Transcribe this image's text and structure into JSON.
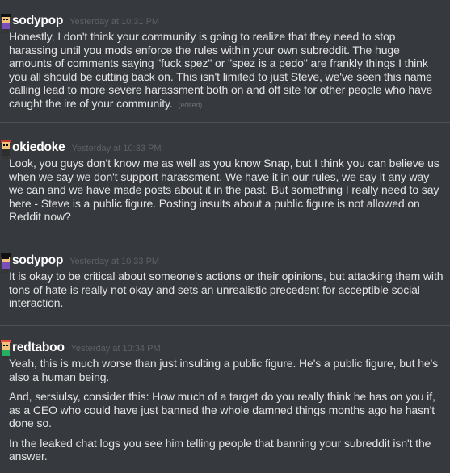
{
  "messages": [
    {
      "author": "sodypop",
      "timestamp": "Yesterday at 10:31 PM",
      "paragraphs": [
        "Honestly, I don't think your community is going to realize that they need to stop harassing until you mods enforce the rules within your own subreddit. The huge amounts of comments saying \"fuck spez\" or \"spez is a pedo\" are frankly things I think you all should be cutting back on. This isn't limited to just Steve, we've seen this name calling lead to more severe harassment both on and off site for other people who have caught the ire of your community."
      ],
      "edited": "(edited)"
    },
    {
      "author": "okiedoke",
      "timestamp": "Yesterday at 10:33 PM",
      "paragraphs": [
        "Look, you guys don't know me as well as you know Snap, but I think you can believe us when we say we don't support harassment. We have it in our rules, we say it any way we can and we have made posts about it in the past. But something I really need to say here - Steve is a public figure. Posting insults about a public figure is not allowed on Reddit now?"
      ]
    },
    {
      "author": "sodypop",
      "timestamp": "Yesterday at 10:33 PM",
      "paragraphs": [
        "It is okay to be critical about someone's actions or their opinions, but attacking them with tons of hate is really not okay and sets an unrealistic precedent for acceptible social interaction."
      ]
    },
    {
      "author": "redtaboo",
      "timestamp": "Yesterday at 10:34 PM",
      "paragraphs": [
        "Yeah, this is much worse than just insulting a public figure. He's a public figure, but he's also a human being.",
        "And, sersiulsy, consider this: How much of a target do you really think he has on you if, as a CEO who could have just banned the whole damned things months ago he hasn't done so.",
        "In the leaked chat logs you see him telling people that banning your subreddit isn't the answer."
      ]
    }
  ],
  "colors": {
    "background": "#36393e",
    "author": "#ffffff",
    "timestamp": "#5e6168",
    "text": "#e3e3e3",
    "divider": "#4c4f55"
  }
}
